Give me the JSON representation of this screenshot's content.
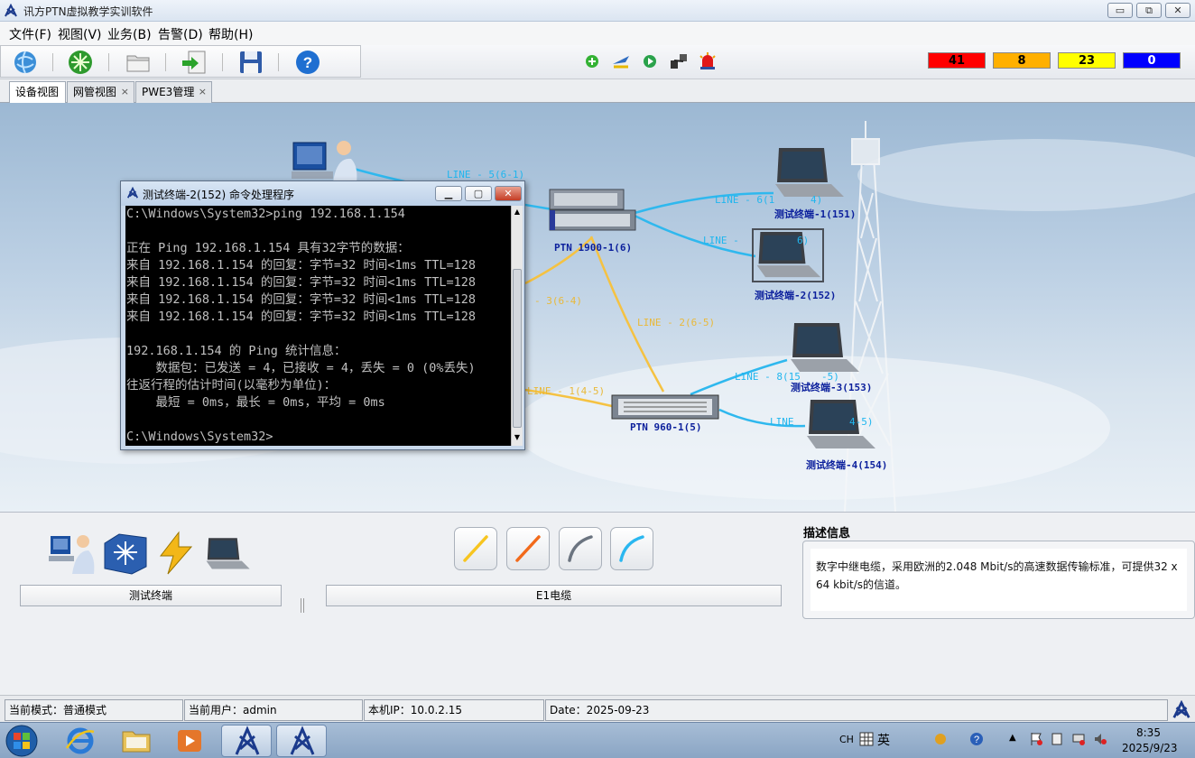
{
  "window": {
    "title": "讯方PTN虚拟教学实训软件",
    "min": "▭",
    "max": "⧉",
    "close": "✕"
  },
  "menu": [
    "文件(F)",
    "视图(V)",
    "业务(B)",
    "告警(D)",
    "帮助(H)"
  ],
  "toolbar_icons": [
    "globe-icon",
    "star-burst-icon",
    "folder-icon",
    "export-icon",
    "save-icon",
    "help-icon"
  ],
  "status_icons": [
    "add-icon",
    "plane-icon",
    "play-icon",
    "network-tool-icon",
    "alarm-light-icon"
  ],
  "alarms": [
    {
      "value": "41",
      "color": "#ff0000",
      "text_color": "#000000"
    },
    {
      "value": "8",
      "color": "#ffb000",
      "text_color": "#000000"
    },
    {
      "value": "23",
      "color": "#ffff00",
      "text_color": "#000000"
    },
    {
      "value": "0",
      "color": "#0000ff",
      "text_color": "#ffffff"
    }
  ],
  "tabs": [
    {
      "label": "设备视图",
      "closable": false
    },
    {
      "label": "网管视图",
      "closable": true
    },
    {
      "label": "PWE3管理",
      "closable": true
    }
  ],
  "topology": {
    "nodes": {
      "ptn1900": "PTN 1900-1(6)",
      "ptn960": "PTN 960-1(5)",
      "t1": "测试终端-1(151)",
      "t2": "测试终端-2(152)",
      "t3": "测试终端-3(153)",
      "t4": "测试终端-4(154)"
    },
    "links": {
      "l5": "LINE - 5(6-1)",
      "l6": "LINE - 6(1",
      "l6b": "4)",
      "l7a": "LINE -",
      "l7b": "6)",
      "l3": "- 3(6-4)",
      "l2": "LINE - 2(6-5)",
      "l8": "LINE - 8(15",
      "l8b": "-5)",
      "l1": "LINE - 1(4-5)",
      "l4a": "LINE",
      "l4b": "4-5)",
      "l6short": "6-",
      "l1900": "1900-1(6)"
    }
  },
  "cmd": {
    "title": "测试终端-2(152) 命令处理程序",
    "lines": [
      "C:\\Windows\\System32>ping 192.168.1.154",
      "",
      "正在 Ping 192.168.1.154 具有32字节的数据：",
      "来自 192.168.1.154 的回复：字节=32 时间<1ms TTL=128",
      "来自 192.168.1.154 的回复：字节=32 时间<1ms TTL=128",
      "来自 192.168.1.154 的回复：字节=32 时间<1ms TTL=128",
      "来自 192.168.1.154 的回复：字节=32 时间<1ms TTL=128",
      "",
      "192.168.1.154 的 Ping 统计信息：",
      "    数据包：已发送 = 4，已接收 = 4，丢失 = 0 (0%丢失)",
      "往返行程的估计时间(以毫秒为单位)：",
      "    最短 = 0ms，最长 = 0ms，平均 = 0ms",
      "",
      "C:\\Windows\\System32>"
    ]
  },
  "palette": {
    "device_label": "测试终端",
    "cable_label": "E1电缆",
    "desc_title": "描述信息",
    "desc_text": "数字中继电缆，采用欧洲的2.048 Mbit/s的高速数据传输标准，可提供32 x 64 kbit/s的信道。",
    "cable_colors": [
      "#f7c520",
      "#f26a1b",
      "#6b7480",
      "#2ab7f0"
    ]
  },
  "status": {
    "mode": "当前模式：普通模式",
    "user": "当前用户：admin",
    "ip": "本机IP：10.0.2.15",
    "date": "Date：2025-09-23"
  },
  "taskbar": {
    "tray_lang": "CH",
    "tray_ime": "英",
    "time": "8:35",
    "date": "2025/9/23"
  }
}
